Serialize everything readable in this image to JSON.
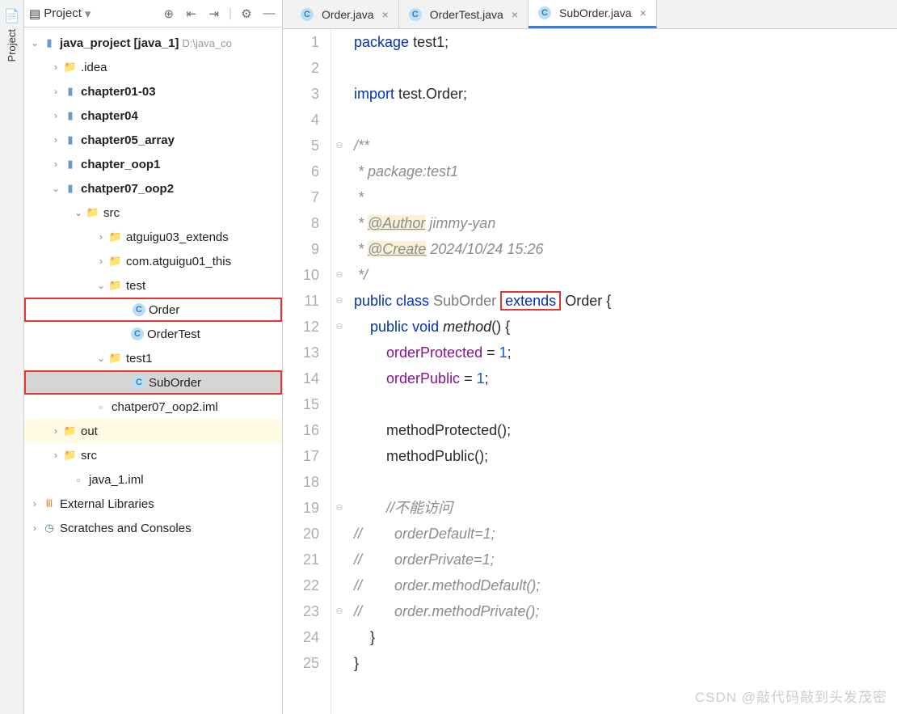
{
  "rail": {
    "label": "Project"
  },
  "panel": {
    "title": "Project",
    "toolbar_icons": [
      "target",
      "collapse",
      "expand",
      "settings",
      "hide"
    ],
    "nodes": {
      "root": "java_project",
      "root_mod": "[java_1]",
      "root_path": "D:\\java_co",
      "idea": ".idea",
      "ch0103": "chapter01-03",
      "ch04": "chapter04",
      "ch05": "chapter05_array",
      "oop1": "chapter_oop1",
      "oop2": "chatper07_oop2",
      "src": "src",
      "pkg_ext": "atguigu03_extends",
      "pkg_this": "com.atguigu01_this",
      "pkg_test": "test",
      "cls_order": "Order",
      "cls_ordertest": "OrderTest",
      "pkg_test1": "test1",
      "cls_suborder": "SubOrder",
      "iml": "chatper07_oop2.iml",
      "out": "out",
      "src2": "src",
      "java1iml": "java_1.iml",
      "extlib": "External Libraries",
      "scratches": "Scratches and Consoles"
    }
  },
  "tabs": [
    {
      "label": "Order.java",
      "active": false
    },
    {
      "label": "OrderTest.java",
      "active": false
    },
    {
      "label": "SubOrder.java",
      "active": true
    }
  ],
  "code": {
    "lines": 25,
    "l1_kw": "package",
    "l1_rest": " test1;",
    "l3_kw": "import",
    "l3_rest": " test.Order;",
    "l5": "/**",
    "l6": " * package:test1",
    "l7": " *",
    "l8_pre": " * ",
    "l8_ann": "@Author",
    "l8_post": " jimmy-yan",
    "l9_pre": " * ",
    "l9_ann": "@Create",
    "l9_post": " 2024/10/24 15:26",
    "l10": " */",
    "l11_public": "public",
    "l11_class": "class",
    "l11_name": "SubOrder",
    "l11_extends": "extends",
    "l11_super": "Order {",
    "l12_public": "public",
    "l12_void": "void",
    "l12_method": "method",
    "l12_rest": "() {",
    "l13_field": "orderProtected",
    "l13_rest": " = ",
    "l13_num": "1",
    "l13_end": ";",
    "l14_field": "orderPublic",
    "l14_rest": " = ",
    "l14_num": "1",
    "l14_end": ";",
    "l16_fn": "methodProtected",
    "l16_rest": "();",
    "l17_fn": "methodPublic",
    "l17_rest": "();",
    "l19": "        //不能访问",
    "l20": "//        orderDefault=1;",
    "l21": "//        orderPrivate=1;",
    "l22": "//        order.methodDefault();",
    "l23": "//        order.methodPrivate();",
    "l24": "    }",
    "l25": "}"
  },
  "watermark": "CSDN @敲代码敲到头发茂密"
}
